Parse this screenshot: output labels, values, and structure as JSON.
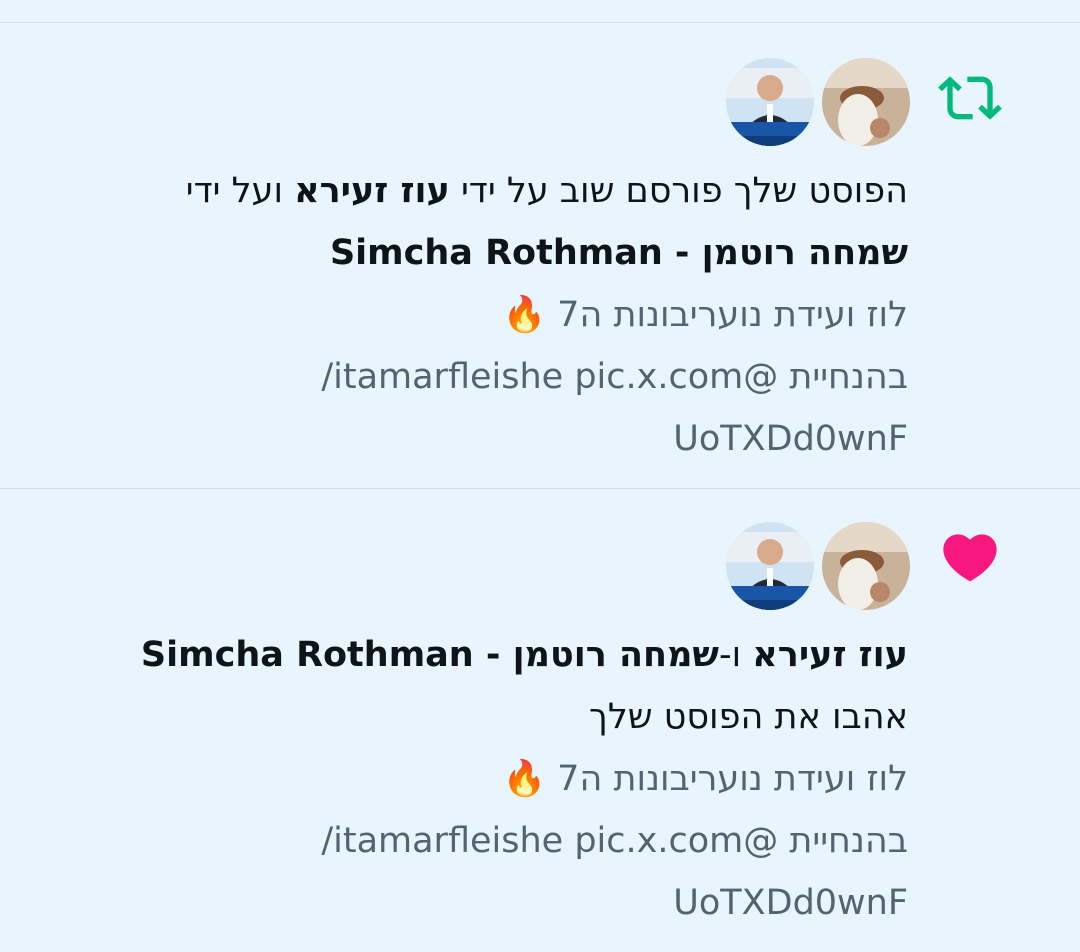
{
  "notifications": [
    {
      "type": "repost",
      "icon": "repost-icon",
      "icon_color": "#00ba7c",
      "headline": {
        "prefix": "הפוסט שלך פורסם שוב על ידי",
        "user1": "עוז זעירא",
        "joiner": "ועל ידי",
        "user2": "שמחה רוטמן - Simcha Rothman"
      },
      "post_lines": [
        "לוז ועידת נועריבונות ה7 🔥",
        "בהנחיית @itamarfleishe pic.x.com/",
        "UoTXDd0wnF"
      ]
    },
    {
      "type": "like",
      "icon": "heart-icon",
      "icon_color": "#f91880",
      "headline": {
        "user1": "עוז זעירא",
        "joiner": "ו-",
        "user2": "שמחה רוטמן - Simcha Rothman",
        "suffix": "אהבו את הפוסט שלך"
      },
      "post_lines": [
        "לוז ועידת נועריבונות ה7 🔥",
        "בהנחיית @itamarfleishe pic.x.com/",
        "UoTXDd0wnF"
      ]
    }
  ],
  "colors": {
    "background": "#e8f5fd",
    "text": "#0f1419",
    "muted": "#536471",
    "divider": "#d3dde4"
  }
}
